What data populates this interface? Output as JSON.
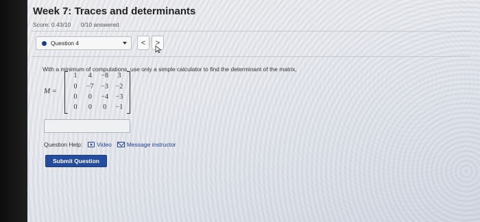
{
  "header": {
    "title": "Week 7: Traces and determinants",
    "score": "Score: 0.43/10",
    "answered": "0/10 answered"
  },
  "question_nav": {
    "selected": "Question 4",
    "prev": "<",
    "next": ">"
  },
  "question": {
    "prompt": "With a minimum of computations, use only a simple calculator to find the determinant of the matrix,",
    "matrix_symbol": "M",
    "equals": "=",
    "matrix": [
      [
        "1",
        "4",
        "−8",
        "3"
      ],
      [
        "0",
        "−7",
        "−3",
        "−2"
      ],
      [
        "0",
        "0",
        "−4",
        "−3"
      ],
      [
        "0",
        "0",
        "0",
        "−1"
      ]
    ],
    "answer_value": ""
  },
  "help": {
    "label": "Question Help:",
    "video": "Video",
    "message": "Message instructor"
  },
  "submit_label": "Submit Question",
  "colors": {
    "primary": "#244c9a",
    "link": "#24408e"
  },
  "icons": {
    "video": "video-icon",
    "message": "mail-icon",
    "dropdown": "chevron-down-icon"
  }
}
